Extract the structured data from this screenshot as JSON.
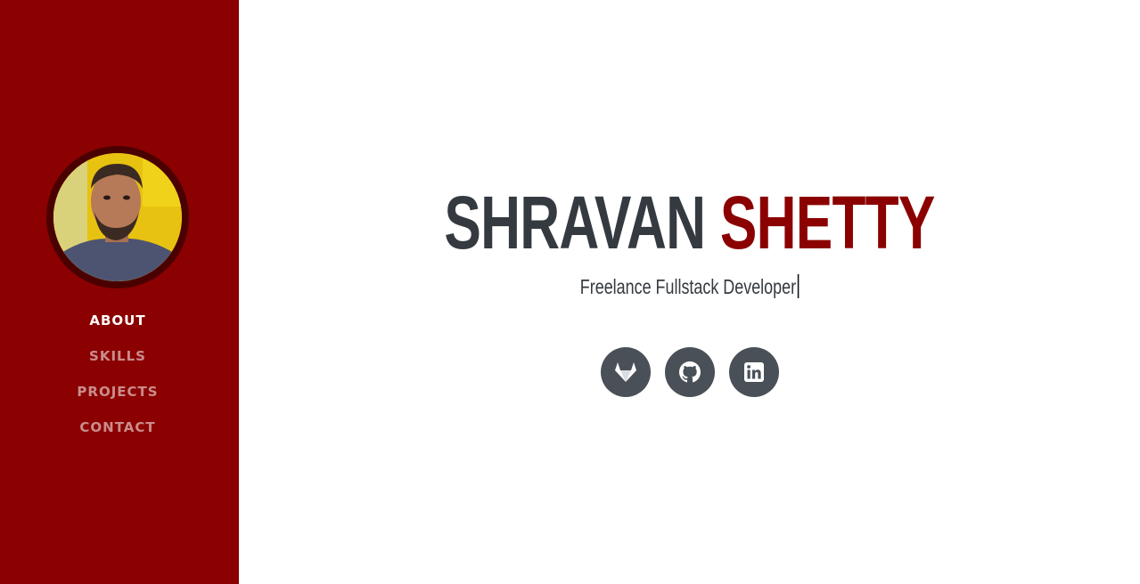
{
  "profile": {
    "first_name": "SHRAVAN",
    "last_name": "SHETTY",
    "subtitle": "Freelance Fullstack Developer"
  },
  "nav": {
    "items": [
      {
        "label": "ABOUT",
        "active": true
      },
      {
        "label": "SKILLS",
        "active": false
      },
      {
        "label": "PROJECTS",
        "active": false
      },
      {
        "label": "CONTACT",
        "active": false
      }
    ]
  },
  "social": [
    {
      "icon": "gitlab-icon"
    },
    {
      "icon": "github-icon"
    },
    {
      "icon": "linkedin-icon"
    }
  ],
  "colors": {
    "sidebar": "#8b0000",
    "accent": "#8b0000",
    "text": "#343a40",
    "social_button": "#495057"
  }
}
